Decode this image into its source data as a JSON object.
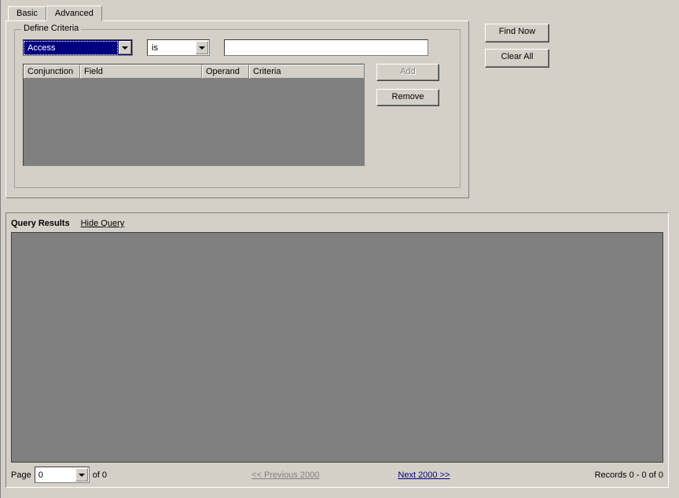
{
  "tabs": {
    "basic": "Basic",
    "advanced": "Advanced"
  },
  "criteria": {
    "legend": "Define Criteria",
    "field_value": "Access",
    "operand_value": "is",
    "criteria_value": "",
    "columns": {
      "conjunction": "Conjunction",
      "field": "Field",
      "operand": "Operand",
      "criteria": "Criteria"
    },
    "add_btn": "Add",
    "remove_btn": "Remove"
  },
  "buttons": {
    "find_now": "Find Now",
    "clear_all": "Clear All"
  },
  "results": {
    "title": "Query Results",
    "hide_query": "Hide Query",
    "page_label": "Page",
    "page_value": "0",
    "of_label": "of 0",
    "prev": "<< Previous 2000",
    "next": "Next 2000 >>",
    "records": "Records 0 - 0 of 0"
  }
}
